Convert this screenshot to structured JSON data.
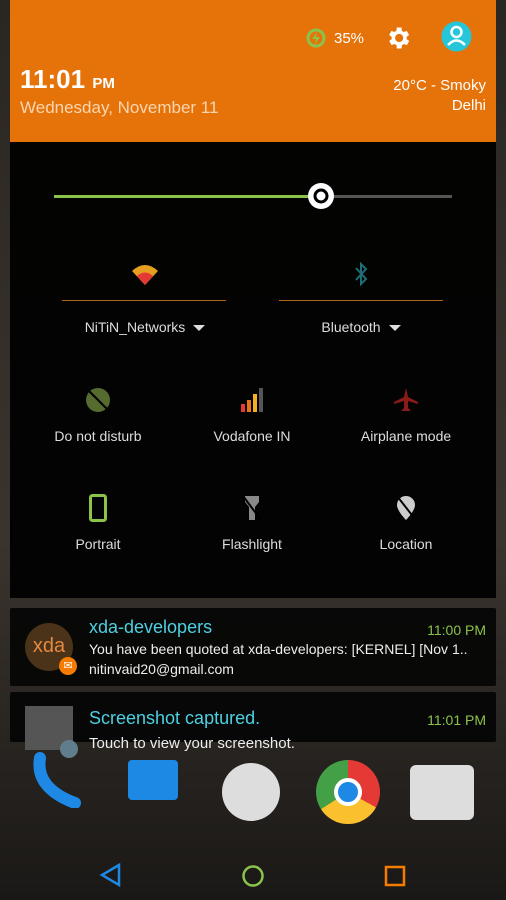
{
  "status": {
    "battery": "35%",
    "battery_level": 35
  },
  "header": {
    "time": "11:01",
    "ampm": "PM",
    "date": "Wednesday, November 11",
    "weather": "20°C - Smoky",
    "city": "Delhi"
  },
  "brightness": {
    "level": 67
  },
  "tiles": [
    {
      "label": "NiTiN_Networks",
      "icon": "wifi-icon"
    },
    {
      "label": "Bluetooth",
      "icon": "bluetooth-icon"
    },
    {
      "label": "Do not disturb",
      "icon": "dnd-icon"
    },
    {
      "label": "Vodafone IN",
      "icon": "signal-icon"
    },
    {
      "label": "Airplane mode",
      "icon": "airplane-icon"
    },
    {
      "label": "Portrait",
      "icon": "portrait-icon"
    },
    {
      "label": "Flashlight",
      "icon": "flashlight-icon"
    },
    {
      "label": "Location",
      "icon": "location-icon"
    }
  ],
  "notifications": [
    {
      "title": "xda-developers",
      "time": "11:00 PM",
      "text": "You have been quoted at xda-developers: [KERNEL] [Nov 1..",
      "sub": "nitinvaid20@gmail.com",
      "logo": "xda"
    },
    {
      "title": "Screenshot captured.",
      "time": "11:01 PM",
      "text": "Touch to view your screenshot."
    }
  ],
  "colors": {
    "accent": "#e5730a",
    "title": "#4dd0e1",
    "time": "#8bc34a"
  }
}
